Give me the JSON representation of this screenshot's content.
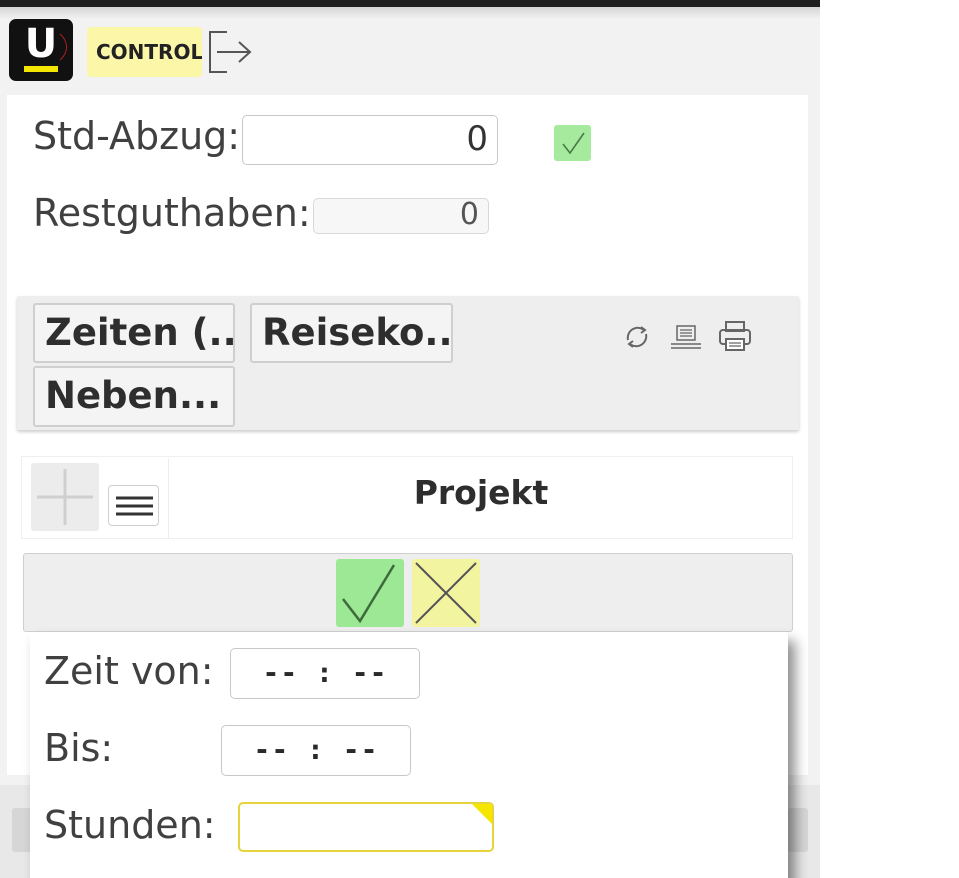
{
  "header": {
    "logo_letter": "U",
    "user_label": "CONTROLLING",
    "logout_icon": "logout-icon"
  },
  "form": {
    "std_abzug_label": "Std-Abzug:",
    "std_abzug_value": "0",
    "restguthaben_label": "Restguthaben:",
    "restguthaben_value": "0",
    "confirm_icon": "checkmark-icon"
  },
  "tabs": [
    {
      "label": "Zeiten (..."
    },
    {
      "label": "Reiseko..."
    },
    {
      "label": "Neben..."
    }
  ],
  "toolbar_icons": [
    "refresh-icon",
    "list-export-icon",
    "printer-icon"
  ],
  "grid": {
    "add_icon": "plus-icon",
    "menu_icon": "hamburger-menu-icon",
    "column_header": "Projekt"
  },
  "actions": {
    "ok_icon": "checkmark-icon",
    "cancel_icon": "x-icon"
  },
  "popup": {
    "zeit_von_label": "Zeit von:",
    "zeit_von_value": "-- : --",
    "bis_label": "Bis:",
    "bis_value": "-- : --",
    "stunden_label": "Stunden:",
    "stunden_value": ""
  },
  "colors": {
    "accent_yellow": "#f5e600",
    "ok_green": "#9ce895",
    "cancel_yellow": "#f3f49f"
  }
}
